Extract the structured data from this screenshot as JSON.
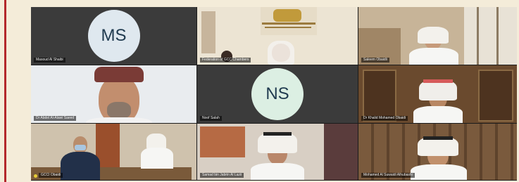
{
  "participants": [
    {
      "initials": "MS",
      "name": "Masoud Al Shaibi",
      "avatar_color": "#dfe8ef"
    },
    {
      "initials": "",
      "name": "Federation of GCC Chambers"
    },
    {
      "initials": "",
      "name": "Saleem Obaidli"
    },
    {
      "initials": "",
      "name": "Dr Abdel Al-Alawi Saeed"
    },
    {
      "initials": "NS",
      "name": "Noof Salah",
      "avatar_color": "#dcefe3"
    },
    {
      "initials": "",
      "name": "Dr Khalid Mohamed Obaidi"
    },
    {
      "initials": "",
      "name": "GCCI Obaidi"
    },
    {
      "initials": "",
      "name": "Samad bin Jabrin Al Lazii"
    },
    {
      "initials": "",
      "name": "Mohamed Al Suwaidi Alhubashi"
    }
  ],
  "colors": {
    "page_bg": "#f4ecd9",
    "accent_rule": "#b3282d",
    "grid_bg": "#1b1b1b"
  }
}
